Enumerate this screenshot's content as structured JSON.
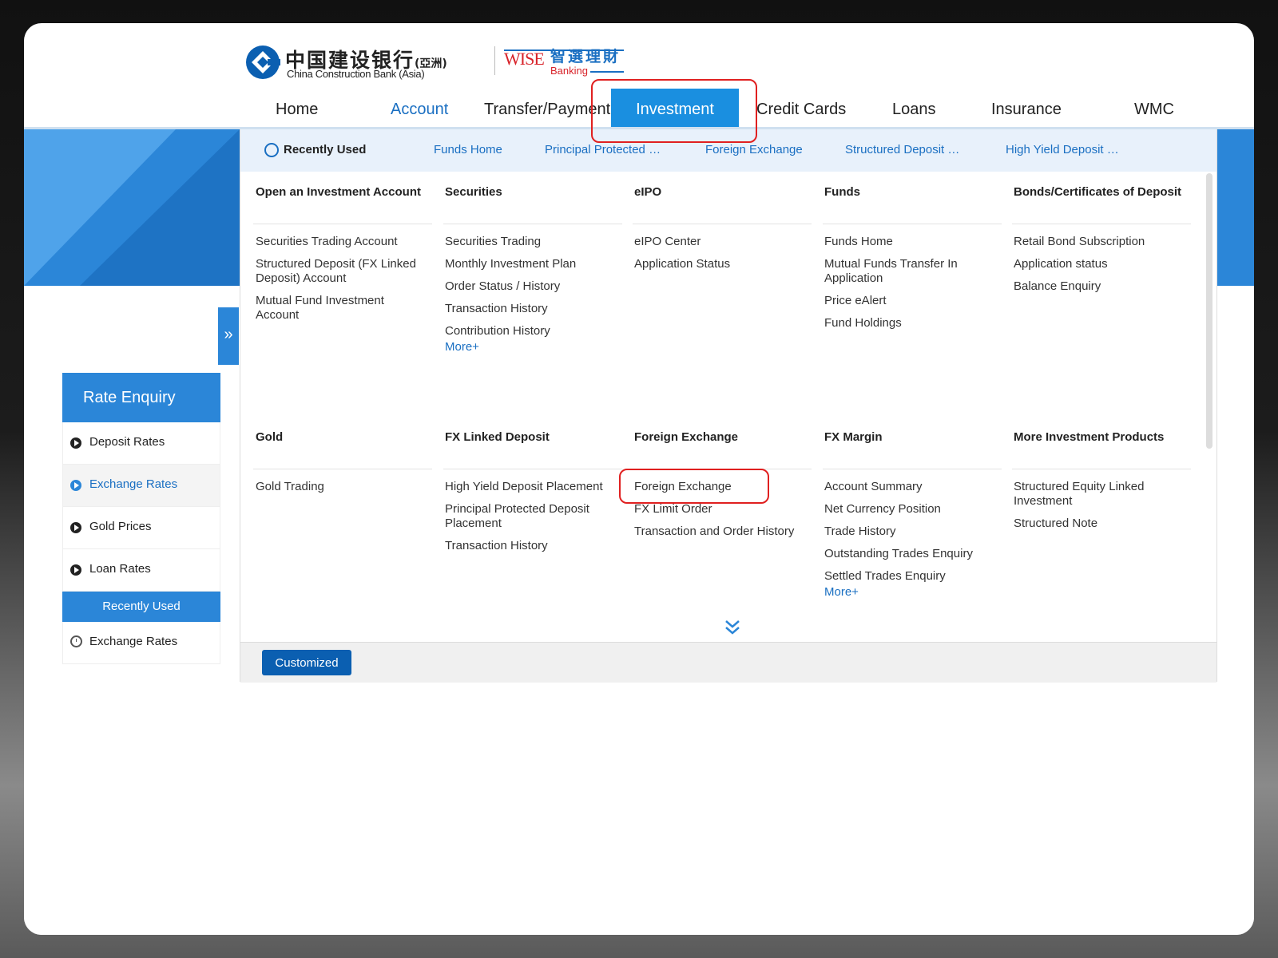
{
  "header": {
    "logo_cn": "中国建设银行",
    "logo_cn_suffix": "(亞洲)",
    "logo_en": "China Construction Bank (Asia)",
    "wise": "WISE",
    "wise_cn": "智選理財",
    "wise_banking": "Banking"
  },
  "topnav": [
    {
      "label": "Home"
    },
    {
      "label": "Account"
    },
    {
      "label": "Transfer/Payment"
    },
    {
      "label": "Investment"
    },
    {
      "label": "Credit Cards"
    },
    {
      "label": "Loans"
    },
    {
      "label": "Insurance"
    },
    {
      "label": "WMC"
    }
  ],
  "recent": {
    "label": "Recently Used",
    "links": [
      "Funds Home",
      "Principal Protected …",
      "Foreign Exchange",
      "Structured Deposit …",
      "High Yield Deposit …"
    ]
  },
  "columns_top": [
    {
      "heading": "Open an Investment Account",
      "items": [
        "Securities Trading Account",
        "Structured Deposit (FX Linked Deposit) Account",
        "Mutual Fund Investment Account"
      ]
    },
    {
      "heading": "Securities",
      "items": [
        "Securities Trading",
        "Monthly Investment Plan",
        "Order Status / History",
        "Transaction History",
        "Contribution History"
      ],
      "more": "More+"
    },
    {
      "heading": "eIPO",
      "items": [
        "eIPO Center",
        "Application Status"
      ]
    },
    {
      "heading": "Funds",
      "items": [
        "Funds Home",
        "Mutual Funds Transfer In Application",
        "Price eAlert",
        "Fund Holdings"
      ]
    },
    {
      "heading": "Bonds/Certificates of Deposit",
      "items": [
        "Retail Bond Subscription",
        "Application status",
        "Balance Enquiry"
      ]
    }
  ],
  "columns_bottom": [
    {
      "heading": "Gold",
      "items": [
        "Gold Trading"
      ]
    },
    {
      "heading": "FX Linked Deposit",
      "items": [
        "High Yield Deposit Placement",
        "Principal Protected Deposit Placement",
        "Transaction History"
      ]
    },
    {
      "heading": "Foreign Exchange",
      "items": [
        "Foreign Exchange",
        "FX Limit Order",
        "Transaction and Order History"
      ]
    },
    {
      "heading": "FX Margin",
      "items": [
        "Account Summary",
        "Net Currency Position",
        "Trade History",
        "Outstanding Trades Enquiry",
        "Settled Trades Enquiry"
      ],
      "more": "More+"
    },
    {
      "heading": "More Investment Products",
      "items": [
        "Structured Equity Linked Investment",
        "Structured Note"
      ]
    }
  ],
  "customized_label": "Customized",
  "sidebar": {
    "title": "Rate Enquiry",
    "items": [
      "Deposit Rates",
      "Exchange Rates",
      "Gold Prices",
      "Loan Rates"
    ],
    "active": "Exchange Rates",
    "recent_title": "Recently Used",
    "recent_items": [
      "Exchange Rates"
    ]
  },
  "colors": {
    "primary": "#2b86d8",
    "link": "#1a6fc2",
    "highlight": "#e02020",
    "button": "#0b5fb1"
  }
}
